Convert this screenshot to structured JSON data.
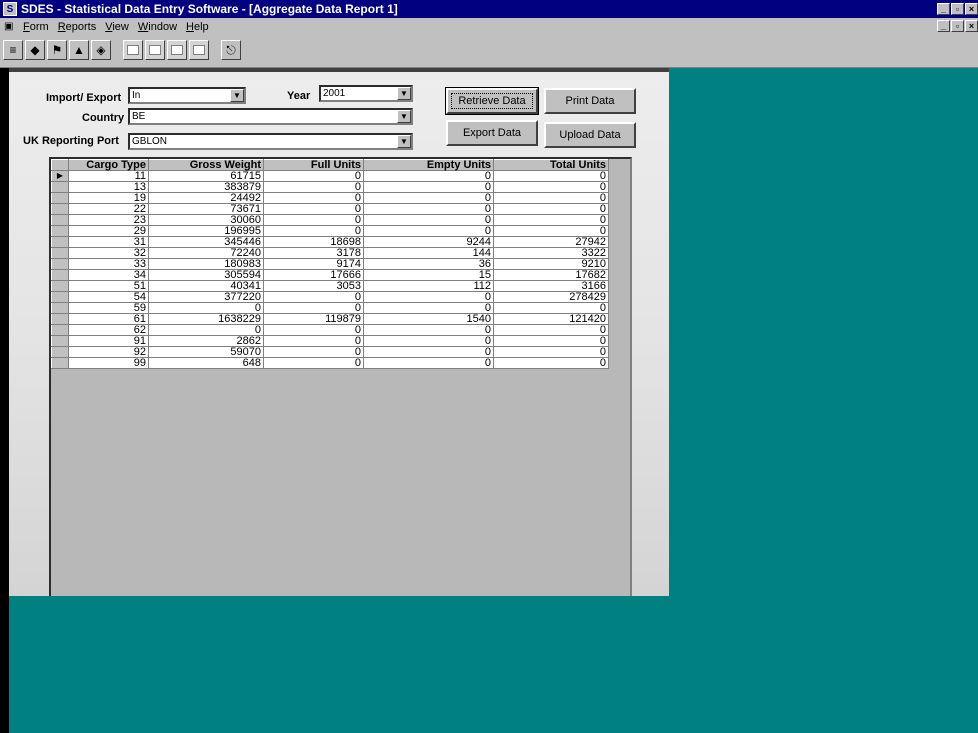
{
  "window": {
    "title": "SDES - Statistical Data Entry Software - [Aggregate Data Report 1]",
    "app_icon": "sdes-app-icon"
  },
  "menubar": {
    "items": [
      "Form",
      "Reports",
      "View",
      "Window",
      "Help"
    ]
  },
  "toolbar": {
    "icons": [
      "stack-icon",
      "package-icon",
      "flag-icon",
      "chart-icon",
      "box-icon",
      "blank-doc-icon",
      "copy-icon",
      "paste-icon",
      "blank-icon",
      "exit-icon"
    ]
  },
  "form": {
    "import_export_label": "Import/ Export",
    "import_export_value": "In",
    "year_label": "Year",
    "year_value": "2001",
    "country_label": "Country",
    "country_value": "BE",
    "port_label": "UK Reporting Port",
    "port_value": "GBLON",
    "retrieve_label": "Retrieve Data",
    "print_label": "Print Data",
    "export_label": "Export Data",
    "upload_label": "Upload Data"
  },
  "grid": {
    "columns": [
      "Cargo Type",
      "Gross Weight",
      "Full Units",
      "Empty Units",
      "Total Units"
    ],
    "rows": [
      [
        "11",
        "61715",
        "0",
        "0",
        "0"
      ],
      [
        "13",
        "383879",
        "0",
        "0",
        "0"
      ],
      [
        "19",
        "24492",
        "0",
        "0",
        "0"
      ],
      [
        "22",
        "73671",
        "0",
        "0",
        "0"
      ],
      [
        "23",
        "30060",
        "0",
        "0",
        "0"
      ],
      [
        "29",
        "196995",
        "0",
        "0",
        "0"
      ],
      [
        "31",
        "345446",
        "18698",
        "9244",
        "27942"
      ],
      [
        "32",
        "72240",
        "3178",
        "144",
        "3322"
      ],
      [
        "33",
        "180983",
        "9174",
        "36",
        "9210"
      ],
      [
        "34",
        "305594",
        "17666",
        "15",
        "17682"
      ],
      [
        "51",
        "40341",
        "3053",
        "112",
        "3166"
      ],
      [
        "54",
        "377220",
        "0",
        "0",
        "278429"
      ],
      [
        "59",
        "0",
        "0",
        "0",
        "0"
      ],
      [
        "61",
        "1638229",
        "119879",
        "1540",
        "121420"
      ],
      [
        "62",
        "0",
        "0",
        "0",
        "0"
      ],
      [
        "91",
        "2862",
        "0",
        "0",
        "0"
      ],
      [
        "92",
        "59070",
        "0",
        "0",
        "0"
      ],
      [
        "99",
        "648",
        "0",
        "0",
        "0"
      ]
    ]
  }
}
